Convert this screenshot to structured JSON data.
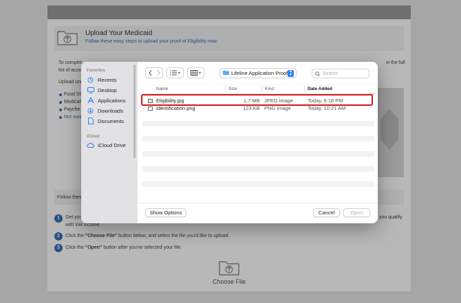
{
  "background_page": {
    "upload_title": "Upload Your Medicaid",
    "upload_subtitle": "Follow these easy steps to upload your proof of Eligibility now:",
    "intro_line_1_start": "To complet",
    "intro_line_1_end": "w the full",
    "intro_line_2": "list of acce",
    "upload_one": "Upload one",
    "bullets": [
      "Food St",
      "Medical",
      "Payche",
      "Not sure"
    ],
    "follow_text": "Follow thes",
    "steps": [
      {
        "num": "1",
        "text": "Get you",
        "text2": "with low income.",
        "end": "you qualify"
      },
      {
        "num": "2",
        "text_pre": "Click the ",
        "text_bold": "\"Choose File\"",
        "text_post": " button below, and select the file you'd like to upload."
      },
      {
        "num": "3",
        "text_pre": "Click the ",
        "text_bold": "\"Open\"",
        "text_post": " button after you've selected your file."
      }
    ],
    "choose_file_label": "Choose File"
  },
  "dialog": {
    "sidebar": {
      "favorites_heading": "Favorites",
      "favorites": [
        {
          "label": "Recents",
          "icon": "clock-icon"
        },
        {
          "label": "Desktop",
          "icon": "desktop-icon"
        },
        {
          "label": "Applications",
          "icon": "applications-icon"
        },
        {
          "label": "Downloads",
          "icon": "download-icon"
        },
        {
          "label": "Documents",
          "icon": "document-icon"
        }
      ],
      "icloud_heading": "iCloud",
      "icloud_items": [
        {
          "label": "iCloud Drive",
          "icon": "cloud-icon"
        }
      ]
    },
    "toolbar": {
      "location": "Lifeline Application Proof...",
      "search_placeholder": "Search"
    },
    "columns": {
      "name": "Name",
      "size": "Size",
      "kind": "Kind",
      "date": "Date Added"
    },
    "files": [
      {
        "name": "Eligibility.jpg",
        "size": "1.7 MB",
        "kind": "JPEG image",
        "date": "Today, 6:18 PM"
      },
      {
        "name": "Identification.png",
        "size": "123 KB",
        "kind": "PNG image",
        "date": "Today, 10:21 AM"
      }
    ],
    "show_options_label": "Show Options",
    "cancel_label": "Cancel",
    "open_label": "Open"
  },
  "colors": {
    "accent": "#2f7cf6",
    "highlight": "#d8131b",
    "link": "#3b6fb6"
  }
}
